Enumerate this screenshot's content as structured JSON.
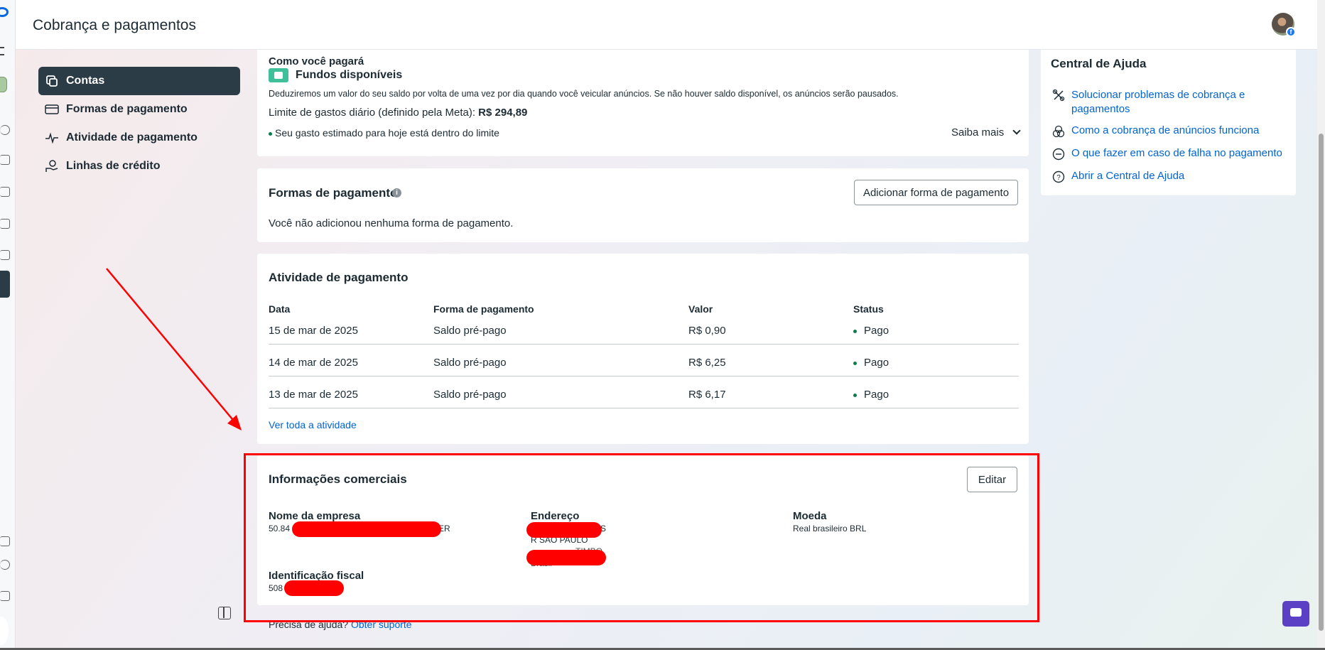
{
  "header": {
    "title": "Cobrança e pagamentos"
  },
  "nav": [
    {
      "label": "Contas",
      "icon": "accounts-icon",
      "active": true
    },
    {
      "label": "Formas de pagamento",
      "icon": "credit-card-icon",
      "active": false
    },
    {
      "label": "Atividade de pagamento",
      "icon": "activity-icon",
      "active": false
    },
    {
      "label": "Linhas de crédito",
      "icon": "credit-line-icon",
      "active": false
    }
  ],
  "funds": {
    "how_pay": "Como você pagará",
    "method": "Fundos disponíveis",
    "description": "Deduziremos um valor do seu saldo por volta de uma vez por dia quando você veicular anúncios. Se não houver saldo disponível, os anúncios serão pausados.",
    "limit_label": "Limite de gastos diário (definido pela Meta):",
    "limit_value": "R$ 294,89",
    "status_text": "Seu gasto estimado para hoje está dentro do limite",
    "learn_more": "Saiba mais"
  },
  "payment_methods": {
    "title": "Formas de pagamento",
    "add_button": "Adicionar forma de pagamento",
    "empty_text": "Você não adicionou nenhuma forma de pagamento."
  },
  "activity": {
    "title": "Atividade de pagamento",
    "columns": [
      "Data",
      "Forma de pagamento",
      "Valor",
      "Status"
    ],
    "rows": [
      {
        "date": "15 de mar de 2025",
        "method": "Saldo pré-pago",
        "value": "R$ 0,90",
        "status": "Pago"
      },
      {
        "date": "14 de mar de 2025",
        "method": "Saldo pré-pago",
        "value": "R$ 6,25",
        "status": "Pago"
      },
      {
        "date": "13 de mar de 2025",
        "method": "Saldo pré-pago",
        "value": "R$ 6,17",
        "status": "Pago"
      }
    ],
    "view_all": "Ver toda a atividade"
  },
  "business": {
    "title": "Informações comerciais",
    "edit_button": "Editar",
    "company_label": "Nome da empresa",
    "company_prefix": "50.84",
    "company_suffix": "ER",
    "address_label": "Endereço",
    "address_line1_suffix": "S",
    "address_line2": "R SAO PAULO",
    "address_line3": "TIMBO",
    "address_line4": "Brasil",
    "currency_label": "Moeda",
    "currency_value": "Real brasileiro BRL",
    "tax_label": "Identificação fiscal",
    "tax_prefix": "508"
  },
  "help_footer": {
    "question": "Precisa de ajuda?",
    "link": "Obter suporte"
  },
  "help_center": {
    "title": "Central de Ajuda",
    "links": [
      {
        "label": "Solucionar problemas de cobrança e pagamentos",
        "icon": "tools-icon"
      },
      {
        "label": "Como a cobrança de anúncios funciona",
        "icon": "coins-icon"
      },
      {
        "label": "O que fazer em caso de falha no pagamento",
        "icon": "minus-circle-icon"
      },
      {
        "label": "Abrir a Central de Ajuda",
        "icon": "question-circle-icon"
      }
    ]
  },
  "colors": {
    "annotation": "#ff0000",
    "active_nav": "#2b3c46",
    "link": "#0064d1",
    "paid": "#0a7d4b",
    "chat": "#5b3fc4"
  }
}
